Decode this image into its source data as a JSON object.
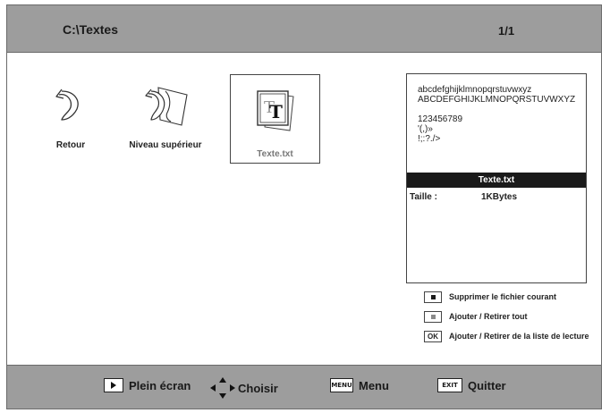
{
  "header": {
    "path": "C:\\Textes",
    "pager": "1/1"
  },
  "items": [
    {
      "label": "Retour",
      "icon": "return-arrow-icon"
    },
    {
      "label": "Niveau supérieur",
      "icon": "parent-folder-icon"
    },
    {
      "label": "Texte.txt",
      "icon": "text-file-icon"
    }
  ],
  "preview": {
    "lines": [
      "abcdefghijklmnopqrstuvwxyz",
      "ABCDEFGHIJKLMNOPQRSTUVWXYZ",
      "123456789",
      "'(,)»",
      "!;:?./>"
    ],
    "filename": "Texte.txt",
    "size_label": "Taille :",
    "size_value": "1KBytes"
  },
  "legend": [
    {
      "key": "",
      "text": "Supprimer le fichier courant",
      "color": "#1a1a1a"
    },
    {
      "key": "",
      "text": "Ajouter / Retirer tout",
      "color": "#8a8a8a"
    },
    {
      "key": "OK",
      "text": "Ajouter / Retirer de la liste de lecture"
    }
  ],
  "footer": {
    "fullscreen": "Plein écran",
    "choose": "Choisir",
    "menu_key": "MENU",
    "menu": "Menu",
    "exit_key": "EXIT",
    "quit": "Quitter"
  },
  "colors": {
    "bar": "#9d9d9d",
    "selected_header": "#1a1a1a"
  }
}
